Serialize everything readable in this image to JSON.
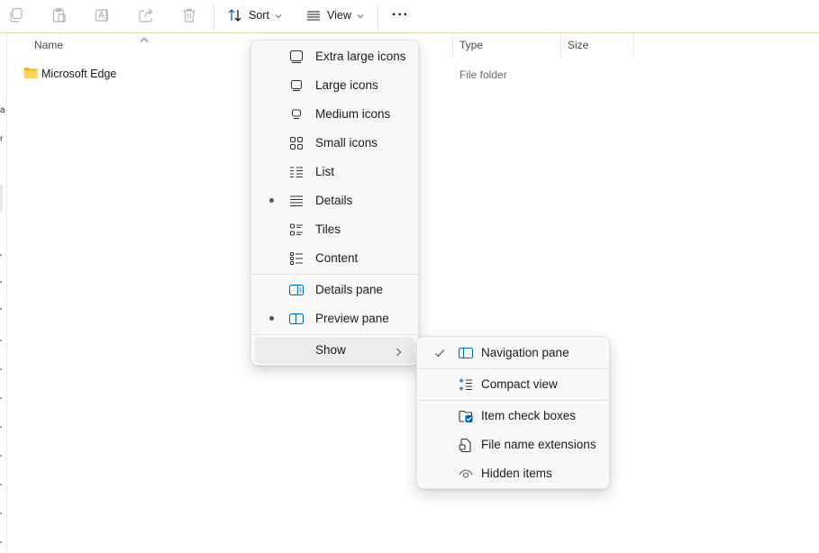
{
  "toolbar": {
    "icons": [
      "copy-icon",
      "paste-icon",
      "rename-icon",
      "share-icon",
      "delete-icon"
    ],
    "sort_label": "Sort",
    "view_label": "View",
    "more_label": "···"
  },
  "columns": {
    "name": "Name",
    "type": "Type",
    "size": "Size"
  },
  "files": [
    {
      "name": "Microsoft Edge",
      "type": "File folder",
      "icon": "folder-icon"
    }
  ],
  "left_strip_chars": [
    "a",
    "r"
  ],
  "view_menu": {
    "items": [
      {
        "label": "Extra large icons",
        "icon": "extra-large-icons-icon",
        "selected": false
      },
      {
        "label": "Large icons",
        "icon": "large-icons-icon",
        "selected": false
      },
      {
        "label": "Medium icons",
        "icon": "medium-icons-icon",
        "selected": false
      },
      {
        "label": "Small icons",
        "icon": "small-icons-icon",
        "selected": false
      },
      {
        "label": "List",
        "icon": "list-icon",
        "selected": false
      },
      {
        "label": "Details",
        "icon": "details-icon",
        "selected": true
      },
      {
        "label": "Tiles",
        "icon": "tiles-icon",
        "selected": false
      },
      {
        "label": "Content",
        "icon": "content-icon",
        "selected": false
      },
      {
        "label": "Details pane",
        "icon": "details-pane-icon",
        "selected": false
      },
      {
        "label": "Preview pane",
        "icon": "preview-pane-icon",
        "selected": true
      },
      {
        "label": "Show",
        "icon": "",
        "selected": false,
        "submenu": true
      }
    ]
  },
  "show_menu": {
    "items": [
      {
        "label": "Navigation pane",
        "icon": "navigation-pane-icon",
        "checked": true
      },
      {
        "label": "Compact view",
        "icon": "compact-view-icon",
        "checked": false
      },
      {
        "label": "Item check boxes",
        "icon": "item-check-boxes-icon",
        "checked": false
      },
      {
        "label": "File name extensions",
        "icon": "file-name-extensions-icon",
        "checked": false
      },
      {
        "label": "Hidden items",
        "icon": "hidden-items-icon",
        "checked": false
      }
    ]
  },
  "colors": {
    "accent": "#0067c0",
    "disabled_icon": "#b4b4b4",
    "folder": "#f7c948",
    "menu_bg": "#f9f9f9",
    "hover": "#ececec"
  }
}
